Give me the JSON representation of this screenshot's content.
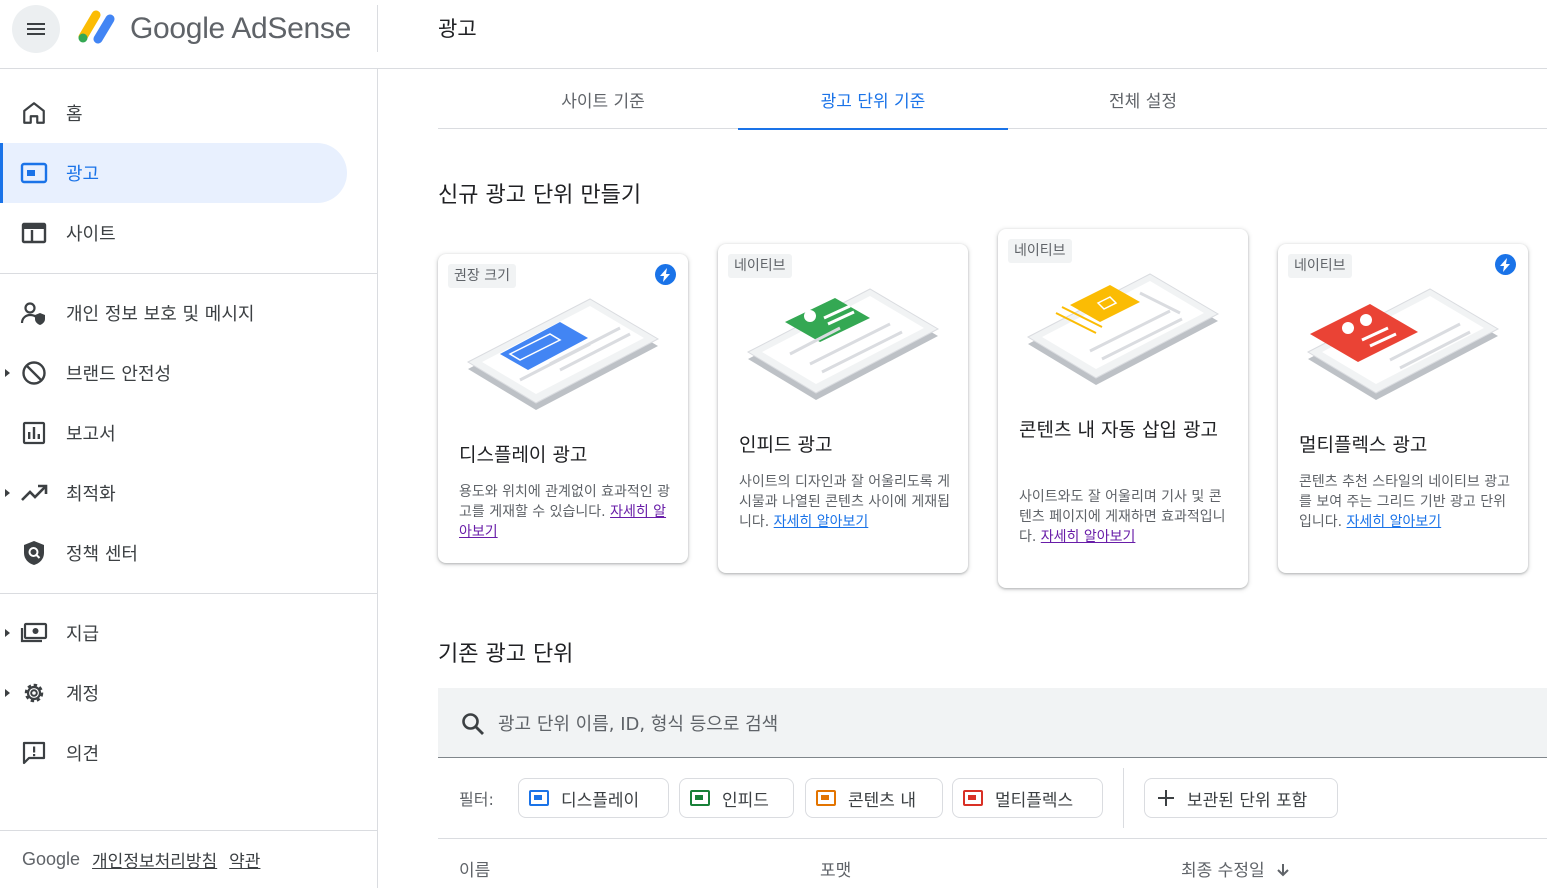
{
  "header": {
    "brand": "Google AdSense",
    "page_title": "광고"
  },
  "sidebar": {
    "items": [
      {
        "label": "홈",
        "icon": "home-icon"
      },
      {
        "label": "광고",
        "icon": "ads-icon"
      },
      {
        "label": "사이트",
        "icon": "sites-icon"
      },
      {
        "label": "개인 정보 보호 및 메시지",
        "icon": "privacy-icon"
      },
      {
        "label": "브랜드 안전성",
        "icon": "block-icon"
      },
      {
        "label": "보고서",
        "icon": "reports-icon"
      },
      {
        "label": "최적화",
        "icon": "trending-icon"
      },
      {
        "label": "정책 센터",
        "icon": "policy-icon"
      },
      {
        "label": "지급",
        "icon": "payments-icon"
      },
      {
        "label": "계정",
        "icon": "gear-icon"
      },
      {
        "label": "의견",
        "icon": "feedback-icon"
      }
    ],
    "footer": {
      "google": "Google",
      "privacy": "개인정보처리방침",
      "terms": "약관"
    }
  },
  "tabs": [
    "사이트 기준",
    "광고 단위 기준",
    "전체 설정"
  ],
  "sections": {
    "new_units": "신규 광고 단위 만들기",
    "existing_units": "기존 광고 단위"
  },
  "cards": [
    {
      "tag": "권장 크기",
      "title": "디스플레이 광고",
      "desc": "용도와 위치에 관계없이 효과적인 광고를 게재할 수 있습니다. ",
      "link": "자세히 알아보기",
      "accent": "#4285f4"
    },
    {
      "tag": "네이티브",
      "title": "인피드 광고",
      "desc": "사이트의 디자인과 잘 어울리도록 게시물과 나열된 콘텐츠 사이에 게재됩니다. ",
      "link": "자세히 알아보기",
      "accent": "#34a853"
    },
    {
      "tag": "네이티브",
      "title": "콘텐츠 내 자동 삽입 광고",
      "desc": "사이트와도 잘 어울리며 기사 및 콘텐츠 페이지에 게재하면 효과적입니다. ",
      "link": "자세히 알아보기",
      "accent": "#fbbc04"
    },
    {
      "tag": "네이티브",
      "title": "멀티플렉스 광고",
      "desc": "콘텐츠 추천 스타일의 네이티브 광고를 보여 주는 그리드 기반 광고 단위입니다. ",
      "link": "자세히 알아보기",
      "accent": "#ea4335"
    }
  ],
  "search": {
    "placeholder": "광고 단위 이름, ID, 형식 등으로 검색"
  },
  "filters": {
    "label": "필터:",
    "chips": [
      {
        "label": "디스플레이",
        "color": "#1a73e8"
      },
      {
        "label": "인피드",
        "color": "#188038"
      },
      {
        "label": "콘텐츠 내",
        "color": "#e37400"
      },
      {
        "label": "멀티플렉스",
        "color": "#d93025"
      }
    ],
    "archived": "보관된 단위 포함"
  },
  "table": {
    "columns": [
      "이름",
      "포맷",
      "최종 수정일"
    ]
  }
}
